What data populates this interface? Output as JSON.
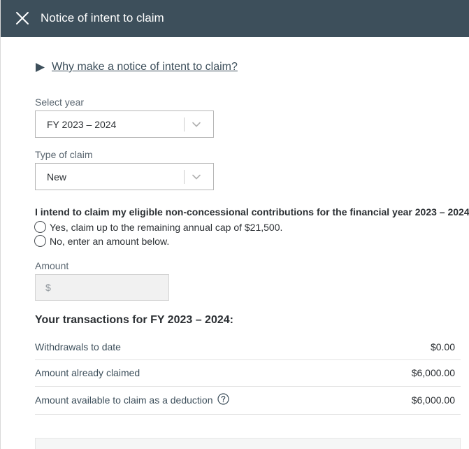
{
  "header": {
    "title": "Notice of intent to claim",
    "close_icon": "close-icon"
  },
  "accordion": {
    "icon": "triangle-right-icon",
    "link_text": "Why make a notice of intent to claim?"
  },
  "year_select": {
    "label": "Select year",
    "value": "FY 2023 – 2024"
  },
  "claim_type_select": {
    "label": "Type of claim",
    "value": "New"
  },
  "intent": {
    "question": "I intend to claim my eligible non-concessional contributions for the financial year 2023 – 2024:",
    "options": [
      {
        "label": "Yes, claim up to the remaining annual cap of $21,500."
      },
      {
        "label": "No, enter an amount below."
      }
    ]
  },
  "amount": {
    "label": "Amount",
    "currency_symbol": "$",
    "value": ""
  },
  "transactions": {
    "heading": "Your transactions for FY 2023 – 2024:",
    "rows": [
      {
        "label": "Withdrawals to date",
        "value": "$0.00"
      },
      {
        "label": "Amount already claimed",
        "value": "$6,000.00"
      },
      {
        "label": "Amount available to claim as a deduction",
        "value": "$6,000.00"
      }
    ]
  },
  "colors": {
    "header_bg": "#3d4f5b",
    "text": "#2b2f33",
    "muted_label": "#5a6670"
  }
}
